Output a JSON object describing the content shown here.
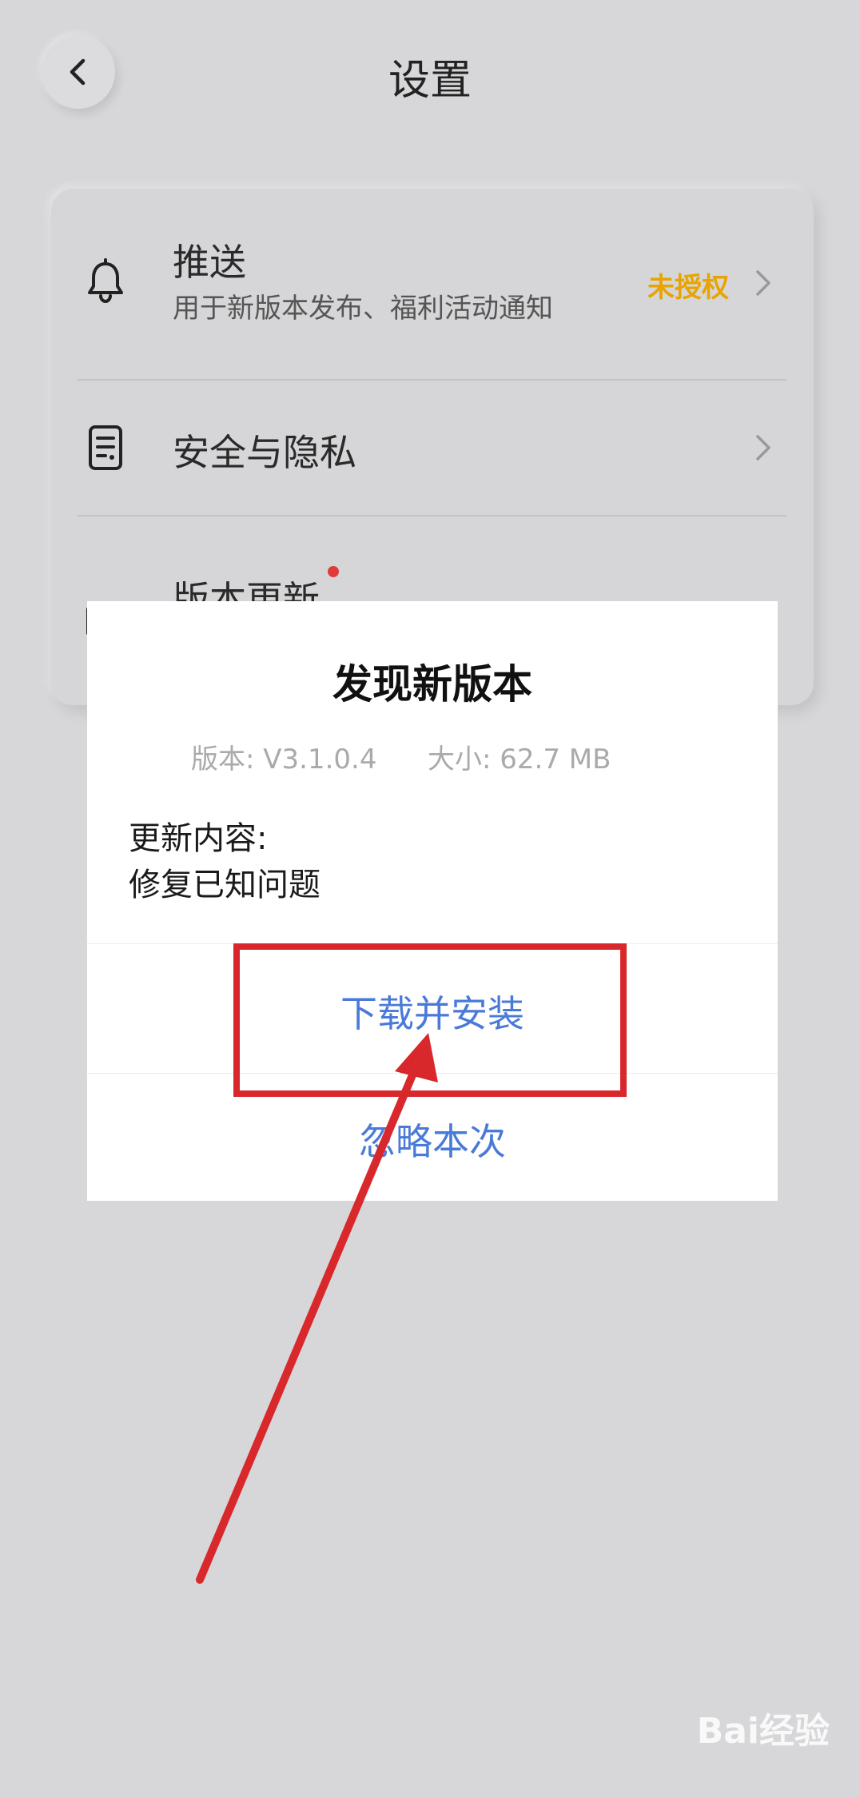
{
  "header": {
    "title": "设置"
  },
  "settings": {
    "items": [
      {
        "title": "推送",
        "subtitle": "用于新版本发布、福利活动通知",
        "status": "未授权",
        "icon": "bell-icon"
      },
      {
        "title": "安全与隐私",
        "icon": "document-shield-icon"
      },
      {
        "title": "版本更新",
        "icon": "update-icon"
      }
    ]
  },
  "dialog": {
    "title": "发现新版本",
    "version": "版本: V3.1.0.4",
    "size": "大小: 62.7 MB",
    "content_label": "更新内容:",
    "content_text": "修复已知问题",
    "primary_button": "下载并安装",
    "secondary_button": "忽略本次"
  },
  "watermark": "Bai经验",
  "colors": {
    "status": "#e8a400",
    "dialog_button": "#4a7ad8",
    "annotation": "#d9282c",
    "badge": "#e23a3a"
  }
}
